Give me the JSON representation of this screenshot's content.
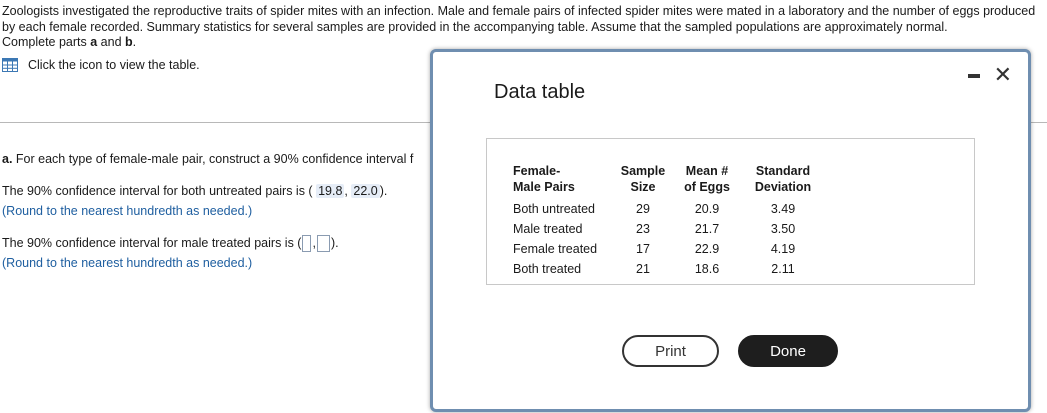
{
  "intro": {
    "text": "Zoologists investigated the reproductive traits of spider mites with an infection. Male and female pairs of infected spider mites were mated in a laboratory and the number of eggs produced by each female recorded. Summary statistics for several samples are provided in the accompanying table. Assume that the sampled populations are approximately normal.",
    "complete_prefix": "Complete parts ",
    "part_a": "a",
    "and": " and ",
    "part_b": "b",
    "period": "."
  },
  "table_link": {
    "label": "Click the icon to view the table.",
    "icon": "table-grid-icon"
  },
  "part_a": {
    "label": "a.",
    "text": " For each type of female-male pair, construct a 90% confidence interval f"
  },
  "q1": {
    "prefix": "The 90% confidence interval for both untreated pairs is (",
    "lower": "19.8",
    "sep": ",",
    "upper": "22.0",
    "suffix": ").",
    "hint": "(Round to the nearest hundredth as needed.)"
  },
  "q2": {
    "prefix": "The 90% confidence interval for male treated pairs is (",
    "sep": ",",
    "suffix": ").",
    "hint": "(Round to the nearest hundredth as needed.)"
  },
  "modal": {
    "title": "Data table",
    "minimize_icon": "minimize-icon",
    "close_icon": "close-icon",
    "close_glyph": "✕",
    "headers": [
      [
        "Female-",
        "Male Pairs"
      ],
      [
        "Sample",
        "Size"
      ],
      [
        "Mean #",
        "of Eggs"
      ],
      [
        "Standard",
        "Deviation"
      ]
    ],
    "rows": [
      [
        "Both untreated",
        "29",
        "20.9",
        "3.49"
      ],
      [
        "Male treated",
        "23",
        "21.7",
        "3.50"
      ],
      [
        "Female treated",
        "17",
        "22.9",
        "4.19"
      ],
      [
        "Both treated",
        "21",
        "18.6",
        "2.11"
      ]
    ],
    "print_label": "Print",
    "done_label": "Done"
  },
  "colors": {
    "accent": "#1f5fa0",
    "modal_border": "#6f8eb0",
    "done_bg": "#1e1e1e",
    "answer_bg": "#e6edf7"
  }
}
